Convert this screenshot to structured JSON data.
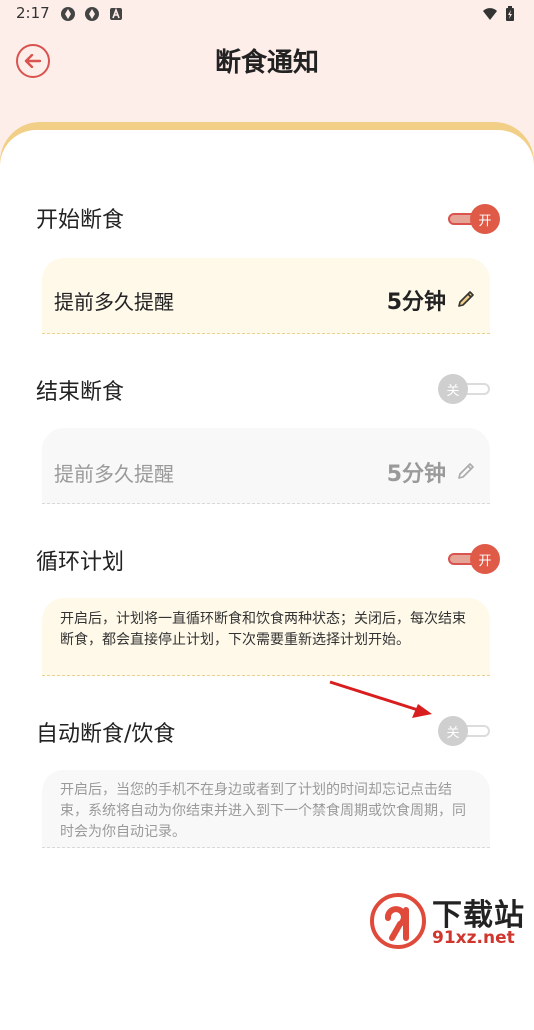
{
  "status": {
    "time": "2:17"
  },
  "header": {
    "title": "断食通知"
  },
  "sections": {
    "start": {
      "title": "开始断食",
      "toggle": "开",
      "reminder_label": "提前多久提醒",
      "reminder_value": "5分钟"
    },
    "end": {
      "title": "结束断食",
      "toggle": "关",
      "reminder_label": "提前多久提醒",
      "reminder_value": "5分钟"
    },
    "cycle": {
      "title": "循环计划",
      "toggle": "开",
      "desc": "开启后，计划将一直循环断食和饮食两种状态；关闭后，每次结束断食，都会直接停止计划，下次需要重新选择计划开始。"
    },
    "auto": {
      "title": "自动断食/饮食",
      "toggle": "关",
      "desc": "开启后，当您的手机不在身边或者到了计划的时间却忘记点击结束，系统将自动为你结束并进入到下一个禁食周期或饮食周期，同时会为你自动记录。"
    }
  },
  "watermark": {
    "line1": "下载站",
    "line2": "91xz.net"
  },
  "colors": {
    "accent": "#e05a48",
    "card_top": "#f2cf86",
    "background": "#fdeeea"
  }
}
